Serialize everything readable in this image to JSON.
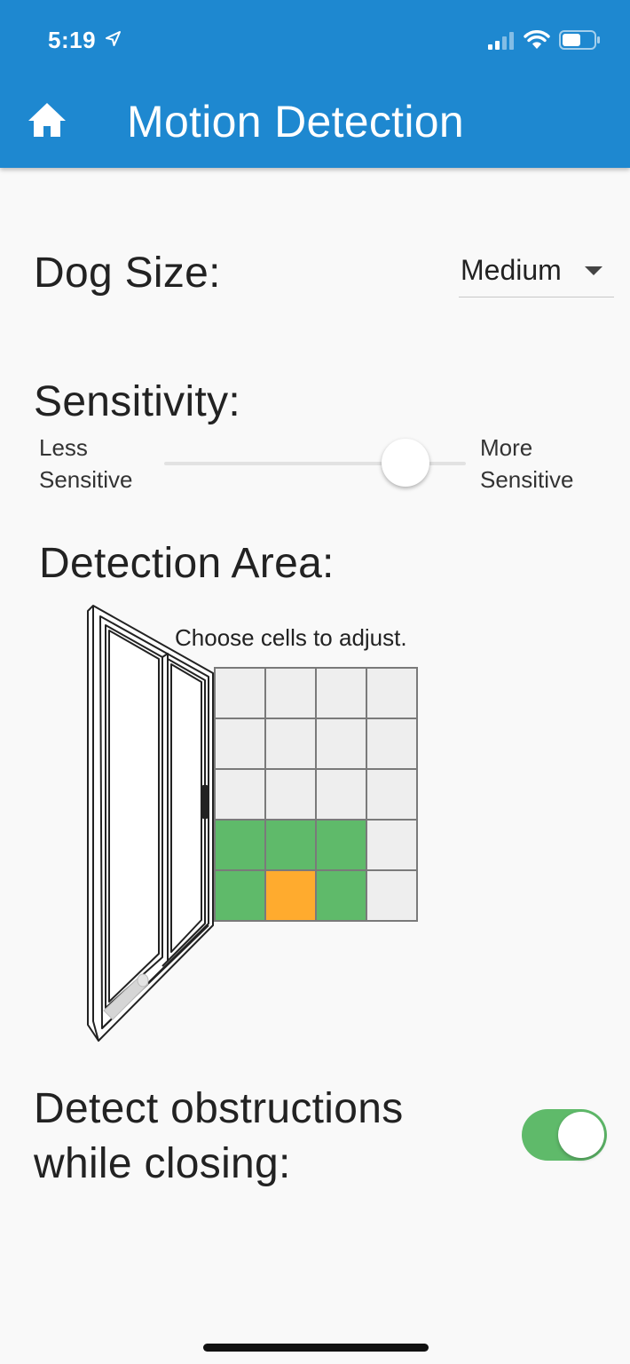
{
  "status_bar": {
    "time": "5:19",
    "icons": [
      "location-arrow-icon",
      "signal-icon",
      "wifi-icon",
      "battery-icon"
    ]
  },
  "app_bar": {
    "title": "Motion Detection",
    "home_icon": "home-icon",
    "background_color": "#1e88d0"
  },
  "dog_size": {
    "label": "Dog Size:",
    "selected": "Medium"
  },
  "sensitivity": {
    "label": "Sensitivity:",
    "min_label_line1": "Less",
    "min_label_line2": "Sensitive",
    "max_label_line1": "More",
    "max_label_line2": "Sensitive",
    "value": 0.8
  },
  "detection_area": {
    "label": "Detection Area:",
    "instruction": "Choose cells to adjust.",
    "colors": {
      "off": "#eeeeee",
      "on": "#5fba6a",
      "selected": "#ffab2e"
    },
    "grid": [
      [
        "off",
        "off",
        "off",
        "off"
      ],
      [
        "off",
        "off",
        "off",
        "off"
      ],
      [
        "off",
        "off",
        "off",
        "off"
      ],
      [
        "on",
        "on",
        "on",
        "off"
      ],
      [
        "on",
        "selected",
        "on",
        "off"
      ]
    ]
  },
  "obstructions": {
    "label_line1": "Detect obstructions",
    "label_line2": "while closing:",
    "enabled": true,
    "toggle_color": "#5fba6a"
  }
}
